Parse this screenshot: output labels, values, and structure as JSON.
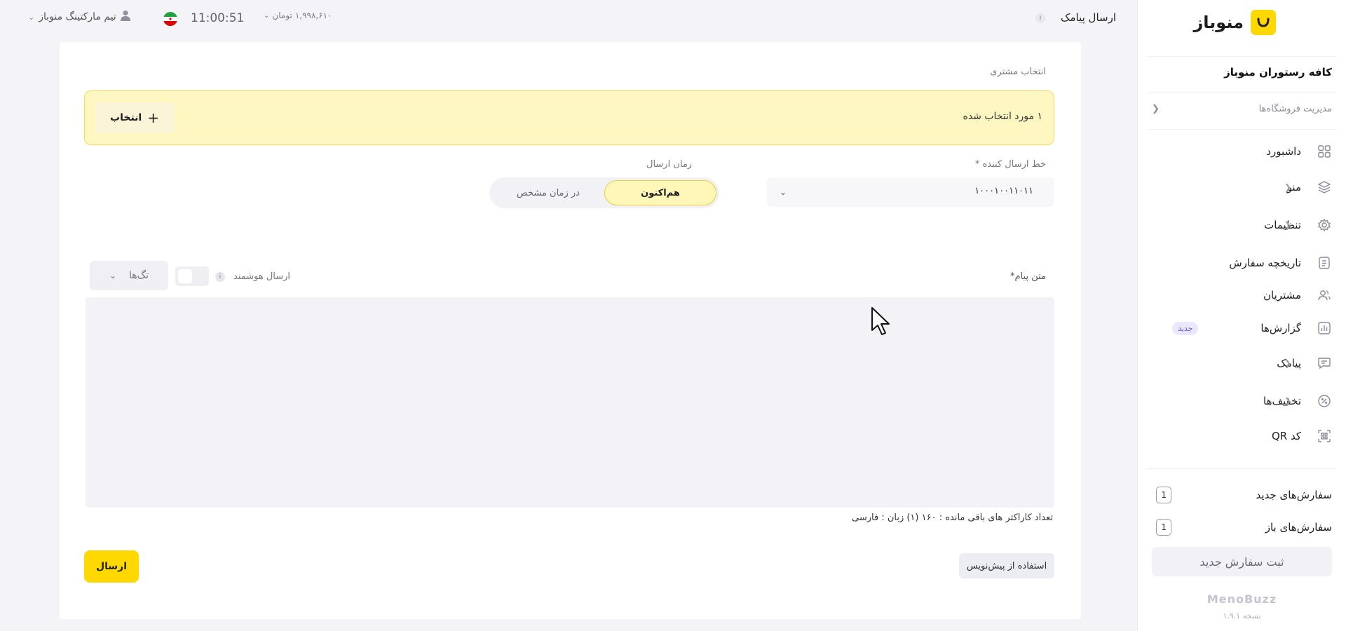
{
  "brand": {
    "name": "منوباز",
    "accent": "#ffd800"
  },
  "store": {
    "name": "کافه رستوران منوباز",
    "manage_label": "مدیریت فروشگاه‌ها"
  },
  "nav": {
    "items": [
      {
        "label": "داشبورد",
        "icon": "dashboard-icon",
        "has_children": false
      },
      {
        "label": "منو",
        "icon": "layers-icon",
        "has_children": true
      },
      {
        "label": "تنظیمات",
        "icon": "gear-icon",
        "has_children": true
      },
      {
        "label": "تاریخچه سفارش",
        "icon": "document-icon",
        "has_children": false
      },
      {
        "label": "مشتریان",
        "icon": "users-icon",
        "has_children": false
      },
      {
        "label": "گزارش‌ها",
        "icon": "chart-icon",
        "has_children": false,
        "badge": "جدید"
      },
      {
        "label": "پیامک",
        "icon": "message-icon",
        "has_children": true
      },
      {
        "label": "تخفیف‌ها",
        "icon": "discount-icon",
        "has_children": true
      },
      {
        "label": "کد QR",
        "icon": "qr-icon",
        "has_children": false
      }
    ]
  },
  "orders": {
    "new_label": "سفارش‌های جدید",
    "new_count": "1",
    "open_label": "سفارش‌های باز",
    "open_count": "1",
    "new_order_button": "ثبت سفارش جدید"
  },
  "footer": {
    "brand": "MenoBuzz",
    "version": "نسخه ۱.۹.۱"
  },
  "topbar": {
    "page_title": "ارسال پیامک",
    "info_glyph": "i",
    "user_name": "تیم مارکتینگ منوباز",
    "clock": "11:00:51",
    "balance_amount": "۱,۹۹۸,۶۱۰",
    "balance_unit": "تومان"
  },
  "form": {
    "customer_label": "انتخاب مشتری",
    "selected_text": "۱ مورد انتخاب شده",
    "select_button": "انتخاب",
    "sender_line_label": "خط ارسال کننده *",
    "sender_line_value": "۱۰۰۰۱۰۰۱۱۰۱۱",
    "send_time_label": "زمان ارسال",
    "send_time_options": {
      "now": "هم‌اکنون",
      "scheduled": "در زمان مشخص"
    },
    "message_label": "متن پیام*",
    "smart_send_label": "ارسال هوشمند",
    "tags_label": "تگ‌ها",
    "message_text": "",
    "chars_remaining": "تعداد کاراکتر های باقی مانده : ۱۶۰ (۱)",
    "language": "زبان : فارسی",
    "draft_button": "استفاده از پیش‌نویس",
    "send_button": "ارسال"
  }
}
